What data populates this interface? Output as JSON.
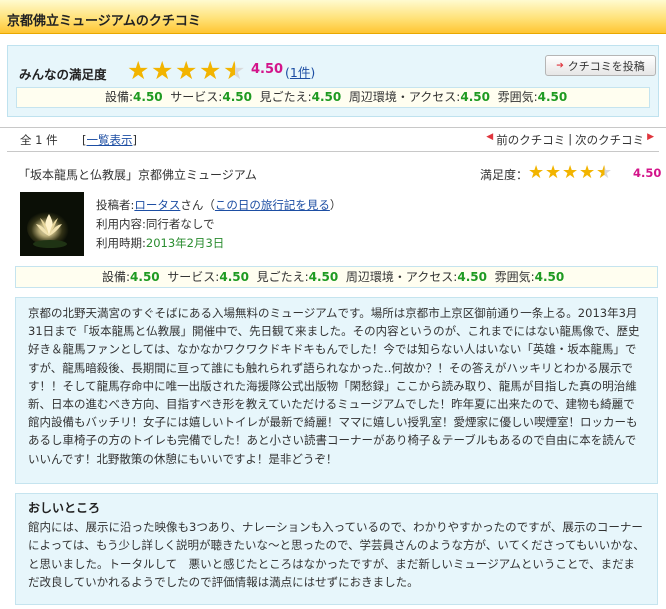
{
  "header": {
    "title": "京都佛立ミュージアムのクチコミ"
  },
  "summary": {
    "label": "みんなの満足度",
    "stars": 4.5,
    "score": "4.50",
    "paren_open": "(",
    "count_link": "1件",
    "paren_close": ")",
    "post_button": "クチコミを投稿",
    "ratings": [
      {
        "name": "設備:",
        "value": "4.50"
      },
      {
        "name": "サービス:",
        "value": "4.50"
      },
      {
        "name": "見ごたえ:",
        "value": "4.50"
      },
      {
        "name": "周辺環境・アクセス:",
        "value": "4.50"
      },
      {
        "name": "雰囲気:",
        "value": "4.50"
      }
    ]
  },
  "pager": {
    "count": "全 1 件",
    "all_link": "一覧表示",
    "bracket_open": "[",
    "bracket_close": "]",
    "prev": "前のクチコミ",
    "separator": "|",
    "next": "次のクチコミ"
  },
  "review": {
    "title": "「坂本龍馬と仏教展」京都佛立ミュージアム",
    "satisfaction_label": "満足度：",
    "stars": 4.5,
    "score": "4.50",
    "poster_label": "投稿者:",
    "poster_name": "ロータス",
    "poster_suffix": "さん（",
    "travel_link": "この日の旅行記を見る",
    "travel_close": "）",
    "companion": "利用内容:同行者なしで",
    "date_label": "利用時期:",
    "date": "2013年2月3日",
    "ratings": [
      {
        "name": "設備:",
        "value": "4.50"
      },
      {
        "name": "サービス:",
        "value": "4.50"
      },
      {
        "name": "見ごたえ:",
        "value": "4.50"
      },
      {
        "name": "周辺環境・アクセス:",
        "value": "4.50"
      },
      {
        "name": "雰囲気:",
        "value": "4.50"
      }
    ],
    "body": "京都の北野天満宮のすぐそばにある入場無料のミュージアムです。場所は京都市上京区御前通り一条上る。2013年3月31日まで「坂本龍馬と仏教展」開催中で、先日観て来ました。その内容というのが、これまでにはない龍馬像で、歴史好き＆龍馬ファンとしては、なかなかワクワクドキドキもんでした！今では知らない人はいない「英雄・坂本龍馬」ですが、龍馬暗殺後、長期間に亘って誰にも触れられず語られなかった‥何故か？！その答えがハッキリとわかる展示です！！そして龍馬存命中に唯一出版された海援隊公式出版物「閑愁録」ここから読み取り、龍馬が目指した真の明治維新、日本の進むべき方向、目指すべき形を教えていただけるミュージアムでした！昨年夏に出来たので、建物も綺麗で館内設備もバッチリ！女子には嬉しいトイレが最新で綺麗！ママに嬉しい授乳室！愛煙家に優しい喫煙室！ロッカーもあるし車椅子の方のトイレも完備でした！あと小さい読書コーナーがあり椅子＆テーブルもあるので自由に本を読んでいいんです！北野散策の休憩にもいいですよ！是非どうぞ！",
    "point_title": "おしいところ",
    "point_body": "館内には、展示に沿った映像も3つあり、ナレーションも入っているので、わかりやすかったのですが、展示のコーナーによっては、もう少し詳しく説明が聴きたいな～と思ったので、学芸員さんのような方が、いてくださってもいいかな、と思いました。トータルして　悪いと感じたところはなかったですが、まだ新しいミュージアムということで、まだまだ改良していかれるようでしたので評価情報は満点にはせずにおきました。"
  },
  "colors": {
    "accent_score": "#d3148a",
    "rating_value": "#1e9a21",
    "link": "#1d4ea3",
    "star": "#f2b400"
  },
  "icons": {
    "star": "star-icon",
    "post_arrow": "arrow-right-icon",
    "prev_arrow": "triangle-left-icon",
    "next_arrow": "triangle-right-icon"
  }
}
